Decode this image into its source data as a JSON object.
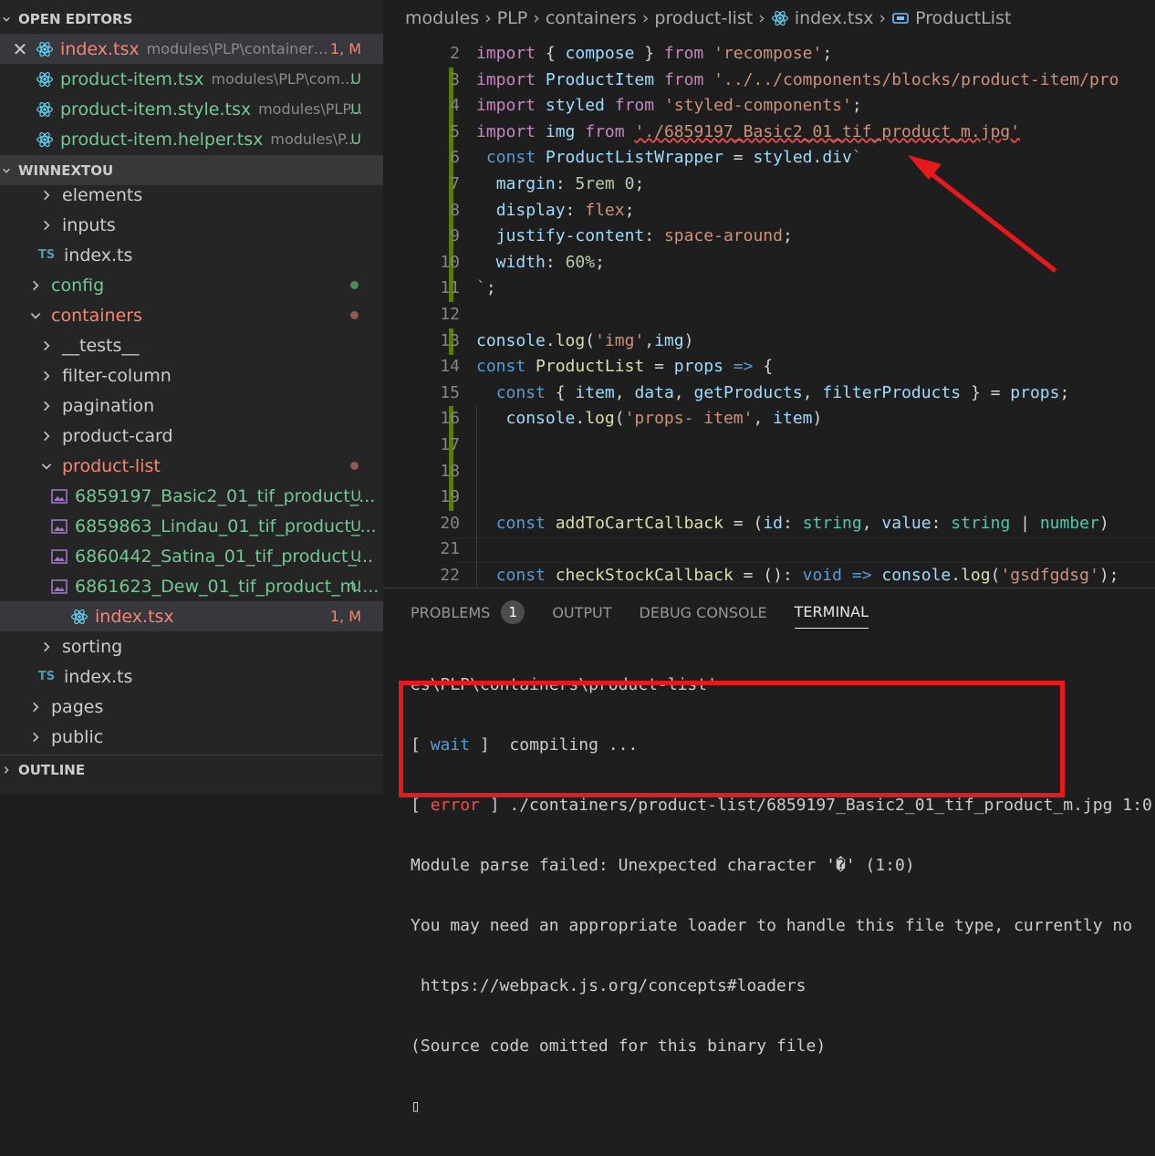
{
  "sidebar": {
    "open_editors_header": "OPEN EDITORS",
    "open_editors": [
      {
        "name": "index.tsx",
        "path": "modules\\PLP\\containers...",
        "badge": "1, M",
        "color": "#f48771",
        "close": true
      },
      {
        "name": "product-item.tsx",
        "path": "modules\\PLP\\com...",
        "badge": "U",
        "color": "#73c991"
      },
      {
        "name": "product-item.style.tsx",
        "path": "modules\\PLP...",
        "badge": "U",
        "color": "#73c991"
      },
      {
        "name": "product-item.helper.tsx",
        "path": "modules\\P...",
        "badge": "U",
        "color": "#73c991"
      }
    ],
    "project_header": "WINNEXTOU",
    "tree": [
      {
        "label": "elements",
        "type": "folder"
      },
      {
        "label": "inputs",
        "type": "folder"
      },
      {
        "label": "index.ts",
        "type": "ts"
      },
      {
        "label": "config",
        "type": "folder",
        "dot": "#4e8b5c"
      },
      {
        "label": "containers",
        "type": "folder-open",
        "dot": "#8f5a52"
      },
      {
        "label": "__tests__",
        "type": "folder"
      },
      {
        "label": "filter-column",
        "type": "folder"
      },
      {
        "label": "pagination",
        "type": "folder"
      },
      {
        "label": "product-card",
        "type": "folder"
      },
      {
        "label": "product-list",
        "type": "folder-open",
        "dot": "#8f5a52"
      },
      {
        "label": "6859197_Basic2_01_tif_product_...",
        "type": "image",
        "badge": "U"
      },
      {
        "label": "6859863_Lindau_01_tif_product_...",
        "type": "image",
        "badge": "U"
      },
      {
        "label": "6860442_Satina_01_tif_product_...",
        "type": "image",
        "badge": "U"
      },
      {
        "label": "6861623_Dew_01_tif_product_m....",
        "type": "image",
        "badge": "U"
      },
      {
        "label": "index.tsx",
        "type": "react",
        "badge": "1, M"
      },
      {
        "label": "sorting",
        "type": "folder"
      },
      {
        "label": "index.ts",
        "type": "ts"
      },
      {
        "label": "pages",
        "type": "folder"
      },
      {
        "label": "public",
        "type": "folder"
      }
    ],
    "outline_header": "OUTLINE",
    "ts_icon_text": "TS"
  },
  "breadcrumb": [
    "modules",
    "PLP",
    "containers",
    "product-list",
    "index.tsx",
    "ProductList"
  ],
  "code": [
    {
      "n": "2",
      "segs": [
        [
          "kw",
          "import"
        ],
        [
          "pl",
          " { "
        ],
        [
          "var",
          "compose"
        ],
        [
          "pl",
          " } "
        ],
        [
          "kw",
          "from"
        ],
        [
          "pl",
          " "
        ],
        [
          "str",
          "'recompose'"
        ],
        [
          "pl",
          ";"
        ]
      ]
    },
    {
      "n": "3",
      "segs": [
        [
          "kw",
          "import"
        ],
        [
          "pl",
          " "
        ],
        [
          "var",
          "ProductItem"
        ],
        [
          "pl",
          " "
        ],
        [
          "kw",
          "from"
        ],
        [
          "pl",
          " "
        ],
        [
          "str",
          "'../../components/blocks/product-item/pro"
        ]
      ]
    },
    {
      "n": "4",
      "segs": [
        [
          "kw",
          "import"
        ],
        [
          "pl",
          " "
        ],
        [
          "var",
          "styled"
        ],
        [
          "pl",
          " "
        ],
        [
          "kw",
          "from"
        ],
        [
          "pl",
          " "
        ],
        [
          "str",
          "'styled-components'"
        ],
        [
          "pl",
          ";"
        ]
      ]
    },
    {
      "n": "5",
      "segs": [
        [
          "kw",
          "import"
        ],
        [
          "pl",
          " "
        ],
        [
          "var",
          "img"
        ],
        [
          "pl",
          " "
        ],
        [
          "kw",
          "from"
        ],
        [
          "pl",
          " "
        ],
        [
          "strsq",
          "'./6859197_Basic2_01_tif_product_m.jpg'"
        ]
      ]
    },
    {
      "n": "6",
      "segs": [
        [
          "pl",
          " "
        ],
        [
          "kw2",
          "const"
        ],
        [
          "pl",
          " "
        ],
        [
          "var",
          "ProductListWrapper"
        ],
        [
          "pl",
          " = "
        ],
        [
          "var",
          "styled"
        ],
        [
          "pl",
          "."
        ],
        [
          "var",
          "div"
        ],
        [
          "str",
          "`"
        ]
      ]
    },
    {
      "n": "7",
      "segs": [
        [
          "pl",
          "  "
        ],
        [
          "prop",
          "margin"
        ],
        [
          "pl",
          ": "
        ],
        [
          "num",
          "5rem"
        ],
        [
          "pl",
          " "
        ],
        [
          "num",
          "0"
        ],
        [
          "pl",
          ";"
        ]
      ]
    },
    {
      "n": "8",
      "segs": [
        [
          "pl",
          "  "
        ],
        [
          "prop",
          "display"
        ],
        [
          "pl",
          ": "
        ],
        [
          "val",
          "flex"
        ],
        [
          "pl",
          ";"
        ]
      ]
    },
    {
      "n": "9",
      "segs": [
        [
          "pl",
          "  "
        ],
        [
          "prop",
          "justify-content"
        ],
        [
          "pl",
          ": "
        ],
        [
          "val",
          "space-around"
        ],
        [
          "pl",
          ";"
        ]
      ]
    },
    {
      "n": "10",
      "segs": [
        [
          "pl",
          "  "
        ],
        [
          "prop",
          "width"
        ],
        [
          "pl",
          ": "
        ],
        [
          "num",
          "60%"
        ],
        [
          "pl",
          ";"
        ]
      ]
    },
    {
      "n": "11",
      "segs": [
        [
          "str",
          "`"
        ],
        [
          "pl",
          ";"
        ]
      ]
    },
    {
      "n": "12",
      "segs": []
    },
    {
      "n": "13",
      "segs": [
        [
          "var",
          "console"
        ],
        [
          "pl",
          "."
        ],
        [
          "fn",
          "log"
        ],
        [
          "pl",
          "("
        ],
        [
          "str",
          "'img'"
        ],
        [
          "pl",
          ","
        ],
        [
          "var",
          "img"
        ],
        [
          "pl",
          ")"
        ]
      ]
    },
    {
      "n": "14",
      "segs": [
        [
          "kw2",
          "const"
        ],
        [
          "pl",
          " "
        ],
        [
          "fn",
          "ProductList"
        ],
        [
          "pl",
          " = "
        ],
        [
          "var",
          "props"
        ],
        [
          "pl",
          " "
        ],
        [
          "kw2",
          "=>"
        ],
        [
          "pl",
          " {"
        ]
      ]
    },
    {
      "n": "15",
      "segs": [
        [
          "pl",
          "  "
        ],
        [
          "kw2",
          "const"
        ],
        [
          "pl",
          " { "
        ],
        [
          "var",
          "item"
        ],
        [
          "pl",
          ", "
        ],
        [
          "var",
          "data"
        ],
        [
          "pl",
          ", "
        ],
        [
          "var",
          "getProducts"
        ],
        [
          "pl",
          ", "
        ],
        [
          "var",
          "filterProducts"
        ],
        [
          "pl",
          " } = "
        ],
        [
          "var",
          "props"
        ],
        [
          "pl",
          ";"
        ]
      ]
    },
    {
      "n": "16",
      "segs": [
        [
          "pl",
          "   "
        ],
        [
          "var",
          "console"
        ],
        [
          "pl",
          "."
        ],
        [
          "fn",
          "log"
        ],
        [
          "pl",
          "("
        ],
        [
          "str",
          "'props- item'"
        ],
        [
          "pl",
          ", "
        ],
        [
          "var",
          "item"
        ],
        [
          "pl",
          ")"
        ]
      ]
    },
    {
      "n": "17",
      "segs": []
    },
    {
      "n": "18",
      "segs": []
    },
    {
      "n": "19",
      "segs": []
    },
    {
      "n": "20",
      "segs": [
        [
          "pl",
          "  "
        ],
        [
          "kw2",
          "const"
        ],
        [
          "pl",
          " "
        ],
        [
          "fn",
          "addToCartCallback"
        ],
        [
          "pl",
          " = ("
        ],
        [
          "var",
          "id"
        ],
        [
          "pl",
          ": "
        ],
        [
          "cls",
          "string"
        ],
        [
          "pl",
          ", "
        ],
        [
          "var",
          "value"
        ],
        [
          "pl",
          ": "
        ],
        [
          "cls",
          "string"
        ],
        [
          "pl",
          " | "
        ],
        [
          "cls",
          "number"
        ],
        [
          "pl",
          ")"
        ]
      ]
    },
    {
      "n": "21",
      "segs": []
    },
    {
      "n": "22",
      "segs": [
        [
          "pl",
          "  "
        ],
        [
          "kw2",
          "const"
        ],
        [
          "pl",
          " "
        ],
        [
          "fn",
          "checkStockCallback"
        ],
        [
          "pl",
          " = (): "
        ],
        [
          "kw2",
          "void"
        ],
        [
          "pl",
          " "
        ],
        [
          "kw2",
          "=>"
        ],
        [
          "pl",
          " "
        ],
        [
          "var",
          "console"
        ],
        [
          "pl",
          "."
        ],
        [
          "fn",
          "log"
        ],
        [
          "pl",
          "("
        ],
        [
          "str",
          "'gsdfgdsg'"
        ],
        [
          "pl",
          ");"
        ]
      ]
    }
  ],
  "panel": {
    "tabs": [
      "PROBLEMS",
      "OUTPUT",
      "DEBUG CONSOLE",
      "TERMINAL"
    ],
    "problems_count": "1",
    "active_tab": "TERMINAL"
  },
  "terminal": {
    "line1": "es\\PLP\\containers\\product-list'",
    "line2_open": "[ ",
    "line2_tag": "wait",
    "line2_rest": " ]  compiling ...",
    "line3_open": "[ ",
    "line3_tag": "error",
    "line3_rest": " ] ./containers/product-list/6859197_Basic2_01_tif_product_m.jpg 1:0",
    "line4": "Module parse failed: Unexpected character '�' (1:0)",
    "line5": "You may need an appropriate loader to handle this file type, currently no",
    "line6": " https://webpack.js.org/concepts#loaders",
    "line7": "(Source code omitted for this binary file)",
    "line8": "▯"
  },
  "colors": {
    "modified": "#f48771",
    "untracked": "#73c991",
    "annotation": "#e8191c"
  }
}
